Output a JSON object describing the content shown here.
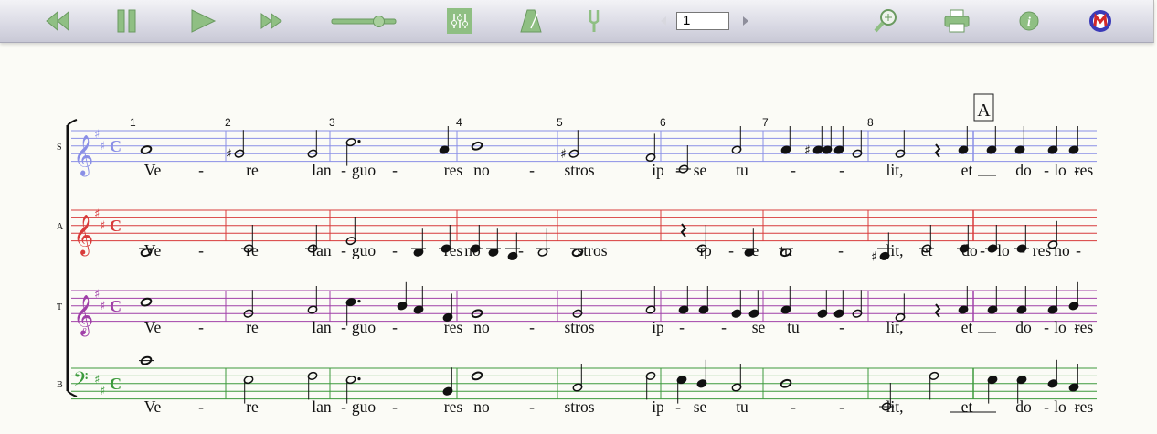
{
  "toolbar": {
    "buttons": [
      {
        "name": "rewind-button",
        "icon": "rewind-icon"
      },
      {
        "name": "pause-button",
        "icon": "pause-icon"
      },
      {
        "name": "play-button",
        "icon": "play-icon"
      },
      {
        "name": "fast-forward-button",
        "icon": "fast-forward-icon"
      },
      {
        "name": "mixer-button",
        "icon": "mixer-icon"
      },
      {
        "name": "metronome-button",
        "icon": "metronome-icon"
      },
      {
        "name": "tuning-fork-button",
        "icon": "tuning-fork-icon"
      },
      {
        "name": "zoom-button",
        "icon": "zoom-in-icon"
      },
      {
        "name": "print-button",
        "icon": "printer-icon"
      },
      {
        "name": "info-button",
        "icon": "info-icon"
      },
      {
        "name": "app-logo-button",
        "icon": "app-logo-icon"
      }
    ],
    "tempo_level": 0.75,
    "page": {
      "value": "1"
    },
    "colors": {
      "icon": "#8fbf83",
      "mixer_bg": "#8fbf83"
    }
  },
  "score": {
    "rehearsal_mark": "A",
    "measure_numbers": [
      "1",
      "2",
      "3",
      "4",
      "5",
      "6",
      "7",
      "8"
    ],
    "key": "D major",
    "time": "C",
    "staves": [
      {
        "label": "S",
        "name": "soprano",
        "color": "#8a8fe6",
        "clef": "treble",
        "lyrics": [
          "Ve",
          "-",
          "re",
          "lan",
          "-",
          "guo",
          "-",
          "res",
          "no",
          "-",
          "stros",
          "ip",
          "-",
          "se",
          "tu",
          "-",
          "-",
          "lit,",
          "et",
          "do",
          "-",
          "lo",
          "-",
          "res"
        ]
      },
      {
        "label": "A",
        "name": "alto",
        "color": "#d83b3b",
        "clef": "treble",
        "lyrics": [
          "Ve",
          "-",
          "re",
          "lan",
          "-",
          "guo",
          "-",
          "res",
          "no",
          "-",
          "-",
          "stros",
          "ip",
          "-",
          "se",
          "tu",
          "-",
          "lit,",
          "et",
          "do",
          "-",
          "lo",
          "-",
          "res",
          "no",
          "-"
        ]
      },
      {
        "label": "T",
        "name": "tenor",
        "color": "#a040a8",
        "clef": "treble-8vb",
        "lyrics": [
          "Ve",
          "-",
          "re",
          "lan",
          "-",
          "guo",
          "-",
          "res",
          "no",
          "-",
          "stros",
          "ip",
          "-",
          "-",
          "se",
          "tu",
          "-",
          "lit,",
          "et",
          "do",
          "-",
          "lo",
          "-",
          "res"
        ]
      },
      {
        "label": "B",
        "name": "bass",
        "color": "#3c9a3c",
        "clef": "bass",
        "lyrics": [
          "Ve",
          "-",
          "re",
          "lan",
          "-",
          "guo",
          "-",
          "res",
          "no",
          "-",
          "stros",
          "ip",
          "-",
          "se",
          "tu",
          "-",
          "-",
          "lit,",
          "et",
          "do",
          "-",
          "lo",
          "-",
          "res"
        ]
      }
    ]
  }
}
